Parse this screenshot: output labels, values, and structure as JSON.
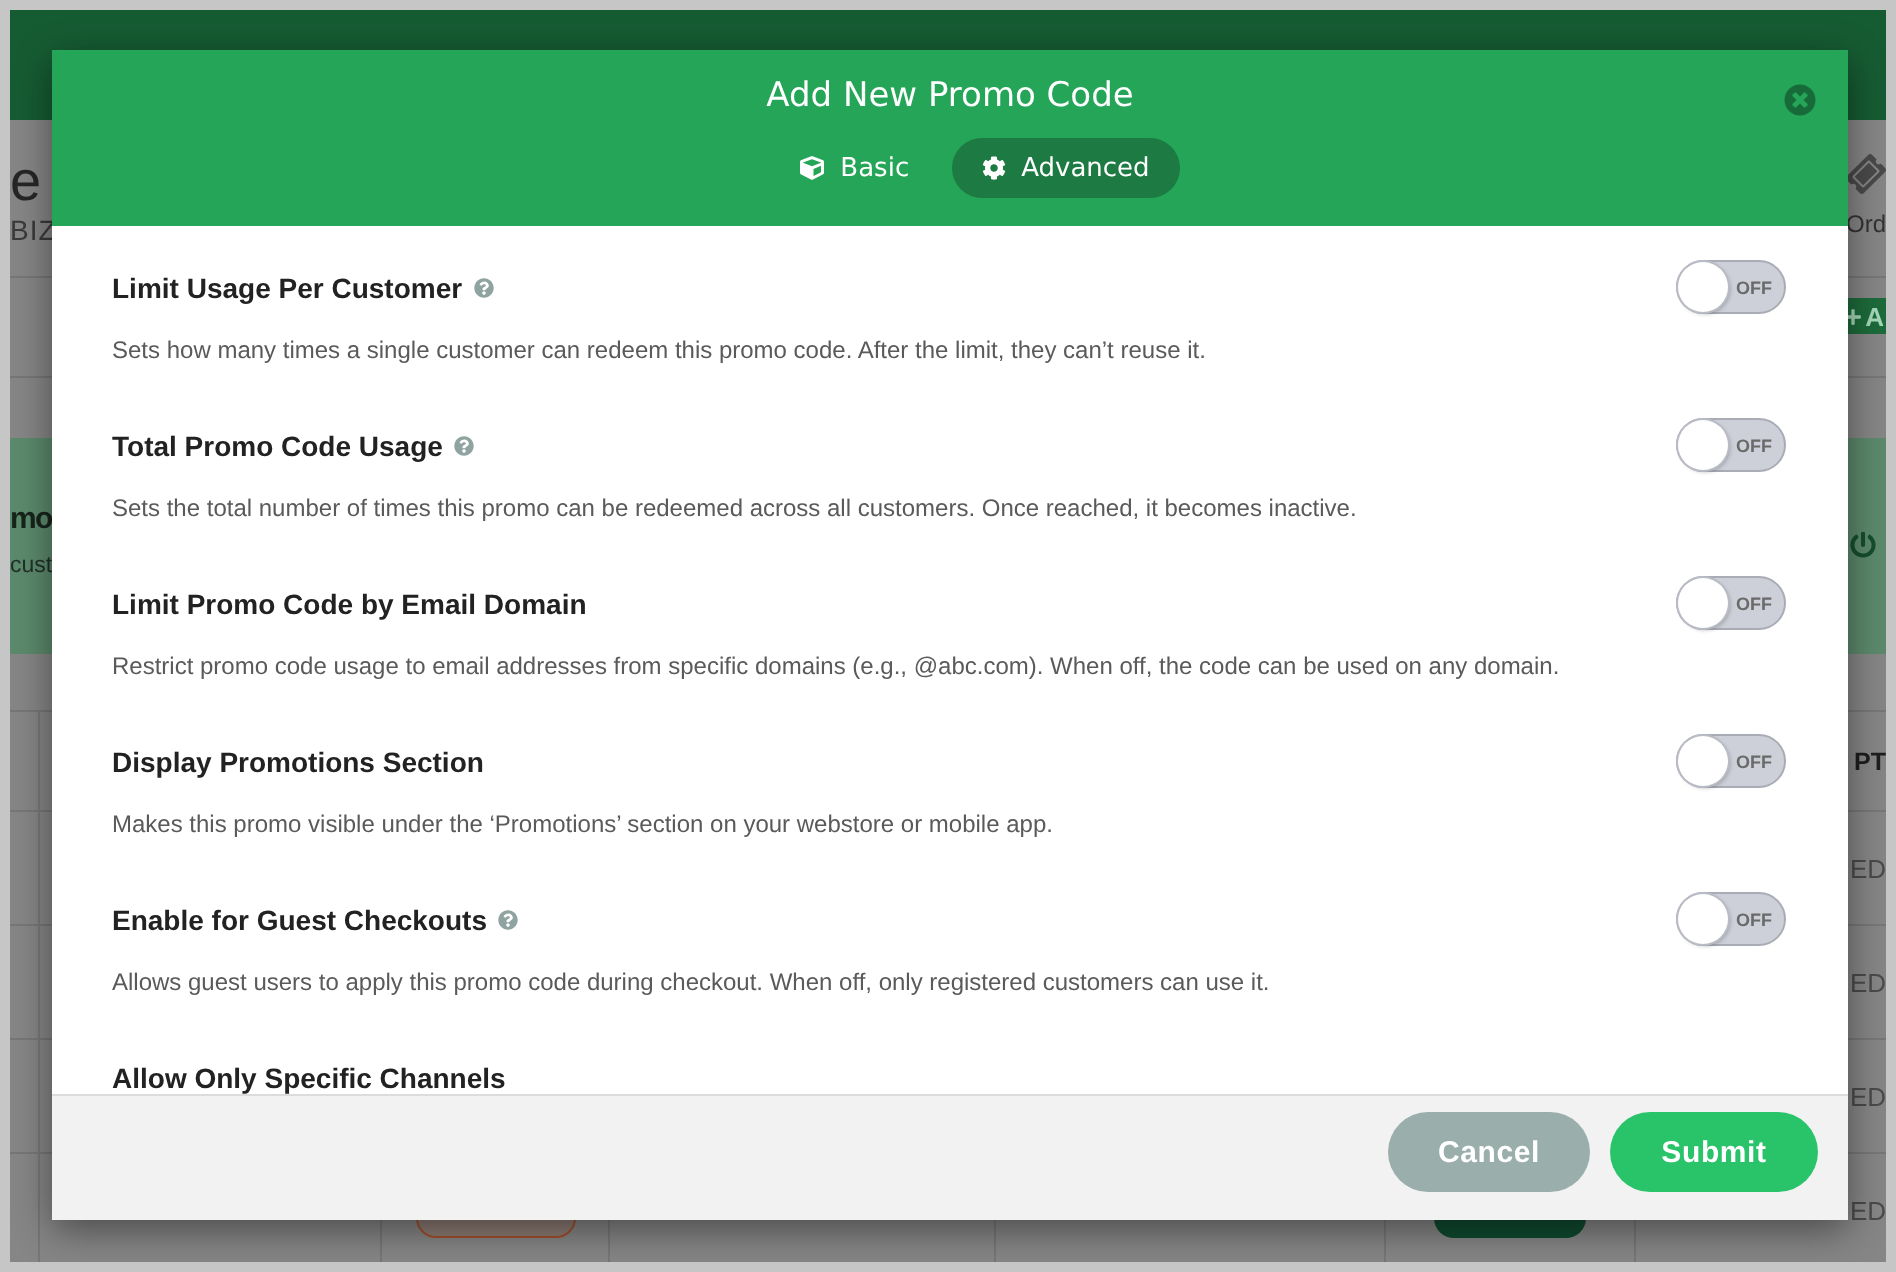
{
  "background_page": {
    "heading": "e",
    "subheading": "BIZ",
    "nav_link": "Ord",
    "add_button": "A",
    "banner": {
      "title": "mo",
      "text": "cust"
    },
    "table": {
      "column_header": "PT",
      "rows": [
        {
          "last_cell": "ED"
        },
        {
          "last_cell": "ED"
        },
        {
          "last_cell": "ED"
        },
        {
          "last_cell": "ED",
          "status_badges": true
        }
      ]
    }
  },
  "modal": {
    "title": "Add New Promo Code",
    "tabs": [
      {
        "label": "Basic",
        "selected": false
      },
      {
        "label": "Advanced",
        "selected": true
      }
    ],
    "settings": [
      {
        "title": "Limit Usage Per Customer",
        "help_icon": true,
        "description": "Sets how many times a single customer can redeem this promo code. After the limit, they can’t reuse it.",
        "on": false,
        "state_label": "OFF"
      },
      {
        "title": "Total Promo Code Usage",
        "help_icon": true,
        "description": "Sets the total number of times this promo can be redeemed across all customers. Once reached, it becomes inactive.",
        "on": false,
        "state_label": "OFF"
      },
      {
        "title": "Limit Promo Code by Email Domain",
        "help_icon": false,
        "description": "Restrict promo code usage to email addresses from specific domains (e.g., @abc.com). When off, the code can be used on any domain.",
        "on": false,
        "state_label": "OFF"
      },
      {
        "title": "Display Promotions Section",
        "help_icon": false,
        "description": "Makes this promo visible under the ‘Promotions’ section on your webstore or mobile app.",
        "on": false,
        "state_label": "OFF"
      },
      {
        "title": "Enable for Guest Checkouts",
        "help_icon": true,
        "description": "Allows guest users to apply this promo code during checkout. When off, only registered customers can use it.",
        "on": false,
        "state_label": "OFF"
      },
      {
        "title": "Allow Only Specific Channels"
      }
    ],
    "buttons": [
      {
        "label": "Cancel",
        "kind": "secondary"
      },
      {
        "label": "Submit",
        "kind": "primary"
      }
    ]
  }
}
